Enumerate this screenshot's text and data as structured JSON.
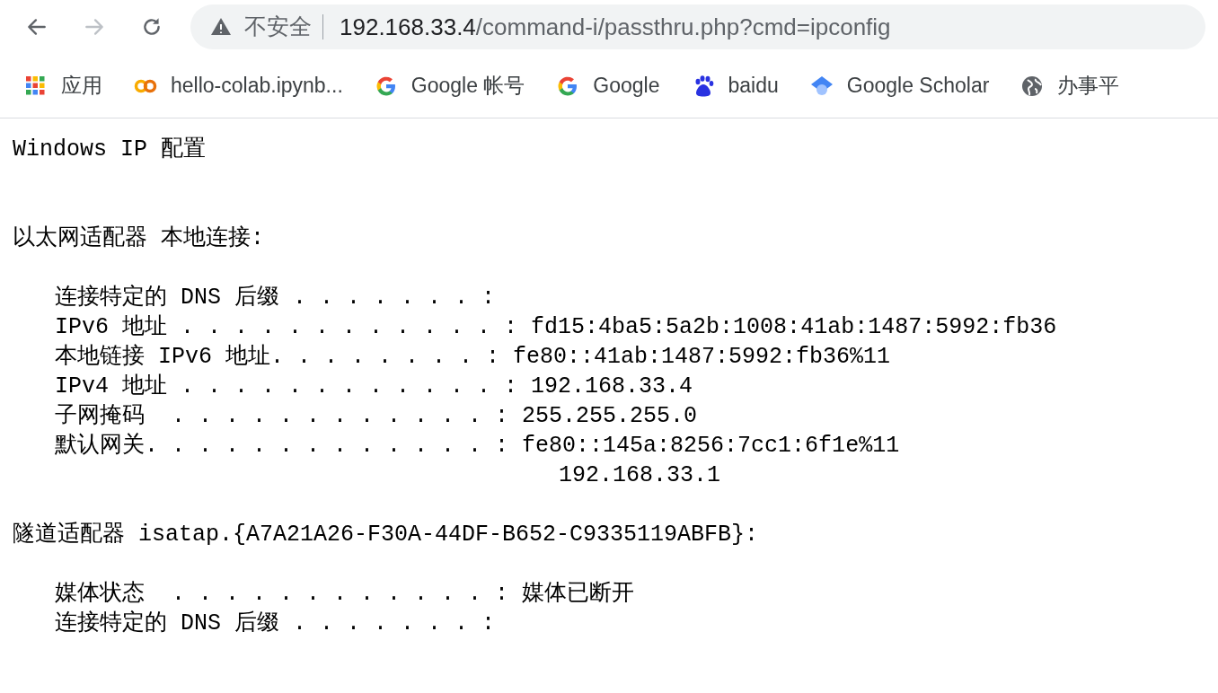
{
  "toolbar": {
    "nav_buttons": [
      {
        "kind": "back",
        "disabled": false
      },
      {
        "kind": "forward",
        "disabled": true
      },
      {
        "kind": "reload",
        "disabled": false
      }
    ],
    "address": {
      "security_label": "不安全",
      "host": "192.168.33.4",
      "path": "/command-i/passthru.php?cmd=ipconfig"
    }
  },
  "bookmarks": [
    {
      "kind": "apps",
      "label": "应用"
    },
    {
      "kind": "colab",
      "label": "hello-colab.ipynb..."
    },
    {
      "kind": "google",
      "label": "Google 帐号"
    },
    {
      "kind": "google",
      "label": "Google"
    },
    {
      "kind": "baidu",
      "label": "baidu"
    },
    {
      "kind": "scholar",
      "label": "Google Scholar"
    },
    {
      "kind": "globe",
      "label": "办事平"
    }
  ],
  "output": {
    "heading": "Windows IP 配置",
    "sections": [
      {
        "title": "以太网适配器 本地连接:",
        "entries": [
          {
            "kind": "line",
            "text": "连接特定的 DNS 后缀 . . . . . . . :"
          },
          {
            "kind": "line",
            "text": "IPv6 地址 . . . . . . . . . . . . : fd15:4ba5:5a2b:1008:41ab:1487:5992:fb36"
          },
          {
            "kind": "line",
            "text": "本地链接 IPv6 地址. . . . . . . . : fe80::41ab:1487:5992:fb36%11"
          },
          {
            "kind": "line",
            "text": "IPv4 地址 . . . . . . . . . . . . : 192.168.33.4"
          },
          {
            "kind": "line",
            "text": "子网掩码  . . . . . . . . . . . . : 255.255.255.0"
          },
          {
            "kind": "line",
            "text": "默认网关. . . . . . . . . . . . . : fe80::145a:8256:7cc1:6f1e%11"
          },
          {
            "kind": "continuation",
            "text": "192.168.33.1"
          }
        ]
      },
      {
        "title": "隧道适配器 isatap.{A7A21A26-F30A-44DF-B652-C9335119ABFB}:",
        "entries": [
          {
            "kind": "line",
            "text": "媒体状态  . . . . . . . . . . . . : 媒体已断开"
          },
          {
            "kind": "line",
            "text": "连接特定的 DNS 后缀 . . . . . . . :"
          }
        ]
      }
    ]
  }
}
